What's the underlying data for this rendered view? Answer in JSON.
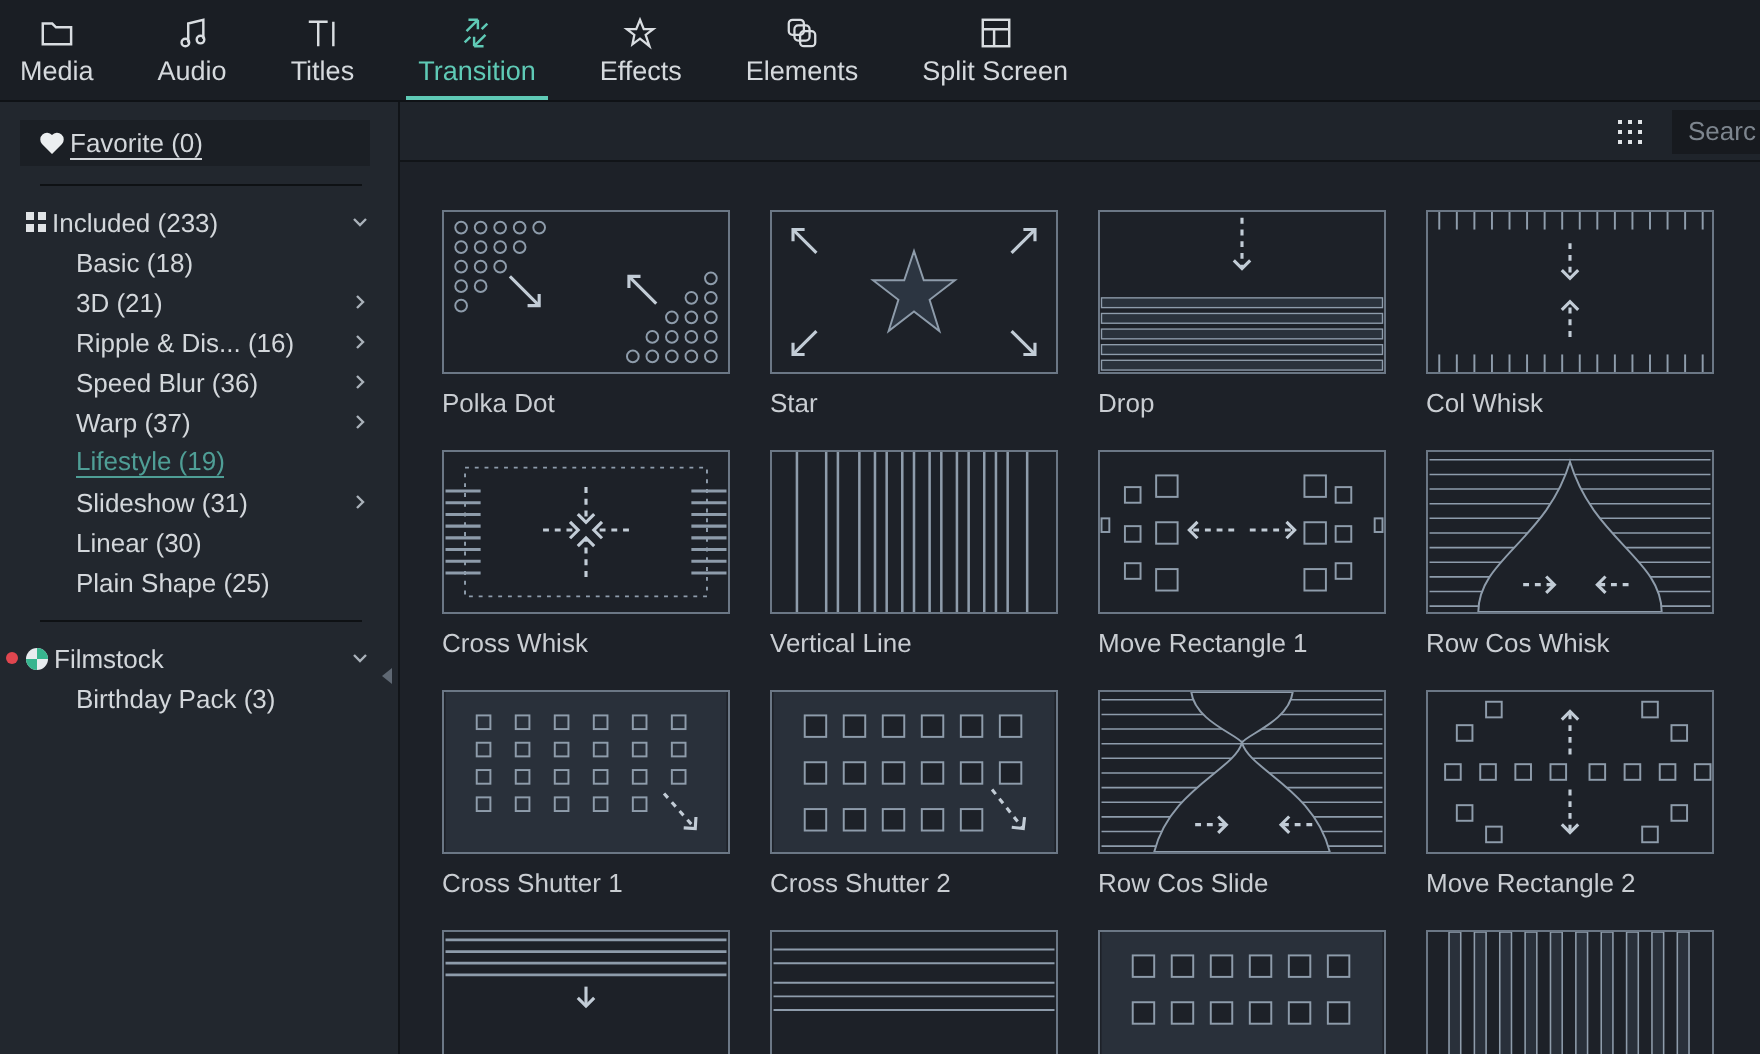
{
  "tabs": [
    {
      "label": "Media",
      "selected": false
    },
    {
      "label": "Audio",
      "selected": false
    },
    {
      "label": "Titles",
      "selected": false
    },
    {
      "label": "Transition",
      "selected": true
    },
    {
      "label": "Effects",
      "selected": false
    },
    {
      "label": "Elements",
      "selected": false
    },
    {
      "label": "Split Screen",
      "selected": false
    }
  ],
  "sidebar": {
    "favorite": {
      "label": "Favorite (0)"
    },
    "groups": [
      {
        "label": "Included (233)",
        "new": false,
        "expanded": true,
        "items": [
          {
            "label": "Basic (18)",
            "submenu": false,
            "selected": false
          },
          {
            "label": "3D (21)",
            "submenu": true,
            "selected": false
          },
          {
            "label": "Ripple & Dis... (16)",
            "submenu": true,
            "selected": false
          },
          {
            "label": "Speed Blur (36)",
            "submenu": true,
            "selected": false
          },
          {
            "label": "Warp (37)",
            "submenu": true,
            "selected": false
          },
          {
            "label": "Lifestyle (19)",
            "submenu": false,
            "selected": true
          },
          {
            "label": "Slideshow (31)",
            "submenu": true,
            "selected": false
          },
          {
            "label": "Linear (30)",
            "submenu": false,
            "selected": false
          },
          {
            "label": "Plain Shape (25)",
            "submenu": false,
            "selected": false
          }
        ]
      },
      {
        "label": "Filmstock",
        "new": true,
        "expanded": true,
        "items": [
          {
            "label": "Birthday Pack (3)",
            "submenu": false,
            "selected": false
          }
        ]
      }
    ]
  },
  "toolbar": {
    "search": {
      "placeholder": "Searc"
    }
  },
  "transitions": [
    {
      "label": "Polka Dot",
      "kind": "dots"
    },
    {
      "label": "Star",
      "kind": "star"
    },
    {
      "label": "Drop",
      "kind": "drop"
    },
    {
      "label": "Col Whisk",
      "kind": "colwhisk"
    },
    {
      "label": "Cross Whisk",
      "kind": "crosswhisk"
    },
    {
      "label": "Vertical Line",
      "kind": "vlines"
    },
    {
      "label": "Move Rectangle 1",
      "kind": "moverect1"
    },
    {
      "label": "Row Cos Whisk",
      "kind": "rowcos"
    },
    {
      "label": "Cross Shutter 1",
      "kind": "shutter1"
    },
    {
      "label": "Cross Shutter 2",
      "kind": "shutter2"
    },
    {
      "label": "Row Cos Slide",
      "kind": "rowcosslide"
    },
    {
      "label": "Move Rectangle 2",
      "kind": "moverect2"
    },
    {
      "kind": "stripedown"
    },
    {
      "kind": "hlines"
    },
    {
      "kind": "squares"
    },
    {
      "kind": "vbars"
    }
  ]
}
